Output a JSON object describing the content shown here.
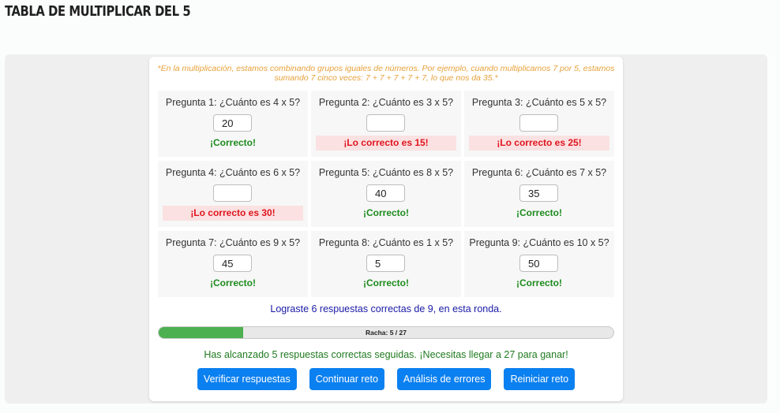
{
  "page": {
    "title": "TABLA DE MULTIPLICAR DEL 5"
  },
  "hint": "*En la multiplicación, estamos combinando grupos iguales de números. Por ejemplo, cuando multiplicamos 7 por 5, estamos sumando 7 cinco veces: 7 + 7 + 7 + 7 + 7, lo que nos da 35.*",
  "questions": [
    {
      "text": "Pregunta 1: ¿Cuánto es 4 x 5?",
      "value": "20",
      "feedback": "¡Correcto!",
      "correct": true
    },
    {
      "text": "Pregunta 2: ¿Cuánto es 3 x 5?",
      "value": "",
      "feedback": "¡Lo correcto es 15!",
      "correct": false
    },
    {
      "text": "Pregunta 3: ¿Cuánto es 5 x 5?",
      "value": "",
      "feedback": "¡Lo correcto es 25!",
      "correct": false
    },
    {
      "text": "Pregunta 4: ¿Cuánto es 6 x 5?",
      "value": "",
      "feedback": "¡Lo correcto es 30!",
      "correct": false
    },
    {
      "text": "Pregunta 5: ¿Cuánto es 8 x 5?",
      "value": "40",
      "feedback": "¡Correcto!",
      "correct": true
    },
    {
      "text": "Pregunta 6: ¿Cuánto es 7 x 5?",
      "value": "35",
      "feedback": "¡Correcto!",
      "correct": true
    },
    {
      "text": "Pregunta 7: ¿Cuánto es 9 x 5?",
      "value": "45",
      "feedback": "¡Correcto!",
      "correct": true
    },
    {
      "text": "Pregunta 8: ¿Cuánto es 1 x 5?",
      "value": "5",
      "feedback": "¡Correcto!",
      "correct": true
    },
    {
      "text": "Pregunta 9: ¿Cuánto es 10 x 5?",
      "value": "50",
      "feedback": "¡Correcto!",
      "correct": true
    }
  ],
  "summary": "Lograste 6 respuestas correctas de 9, en esta ronda.",
  "progress": {
    "label": "Racha: 5 / 27",
    "current": 5,
    "goal": 27
  },
  "streak_message": "Has alcanzado 5 respuestas correctas seguidas. ¡Necesitas llegar a 27 para ganar!",
  "buttons": {
    "verify": "Verificar respuestas",
    "continue": "Continuar reto",
    "analysis": "Análisis de errores",
    "restart": "Reiniciar reto"
  },
  "colors": {
    "accent": "#0b80f0",
    "progress": "#4caf50",
    "correct": "#1d8a1d",
    "incorrect": "#e0141e",
    "hint": "#e8a13a"
  }
}
